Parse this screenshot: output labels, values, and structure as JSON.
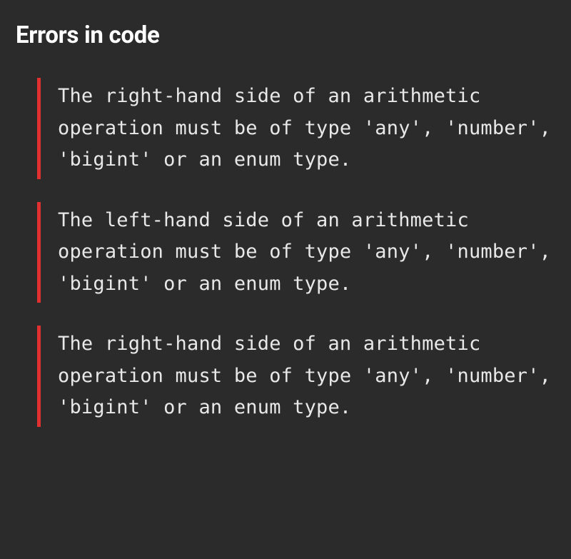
{
  "section": {
    "title": "Errors in code"
  },
  "errors": [
    {
      "message": "The right-hand side of an arithmetic operation must be of type 'any', 'number', 'bigint' or an enum type."
    },
    {
      "message": "The left-hand side of an arithmetic operation must be of type 'any', 'number', 'bigint' or an enum type."
    },
    {
      "message": "The right-hand side of an arithmetic operation must be of type 'any', 'number', 'bigint' or an enum type."
    }
  ],
  "colors": {
    "background": "#2b2b2b",
    "text": "#e8e8e8",
    "accent": "#e03030"
  }
}
